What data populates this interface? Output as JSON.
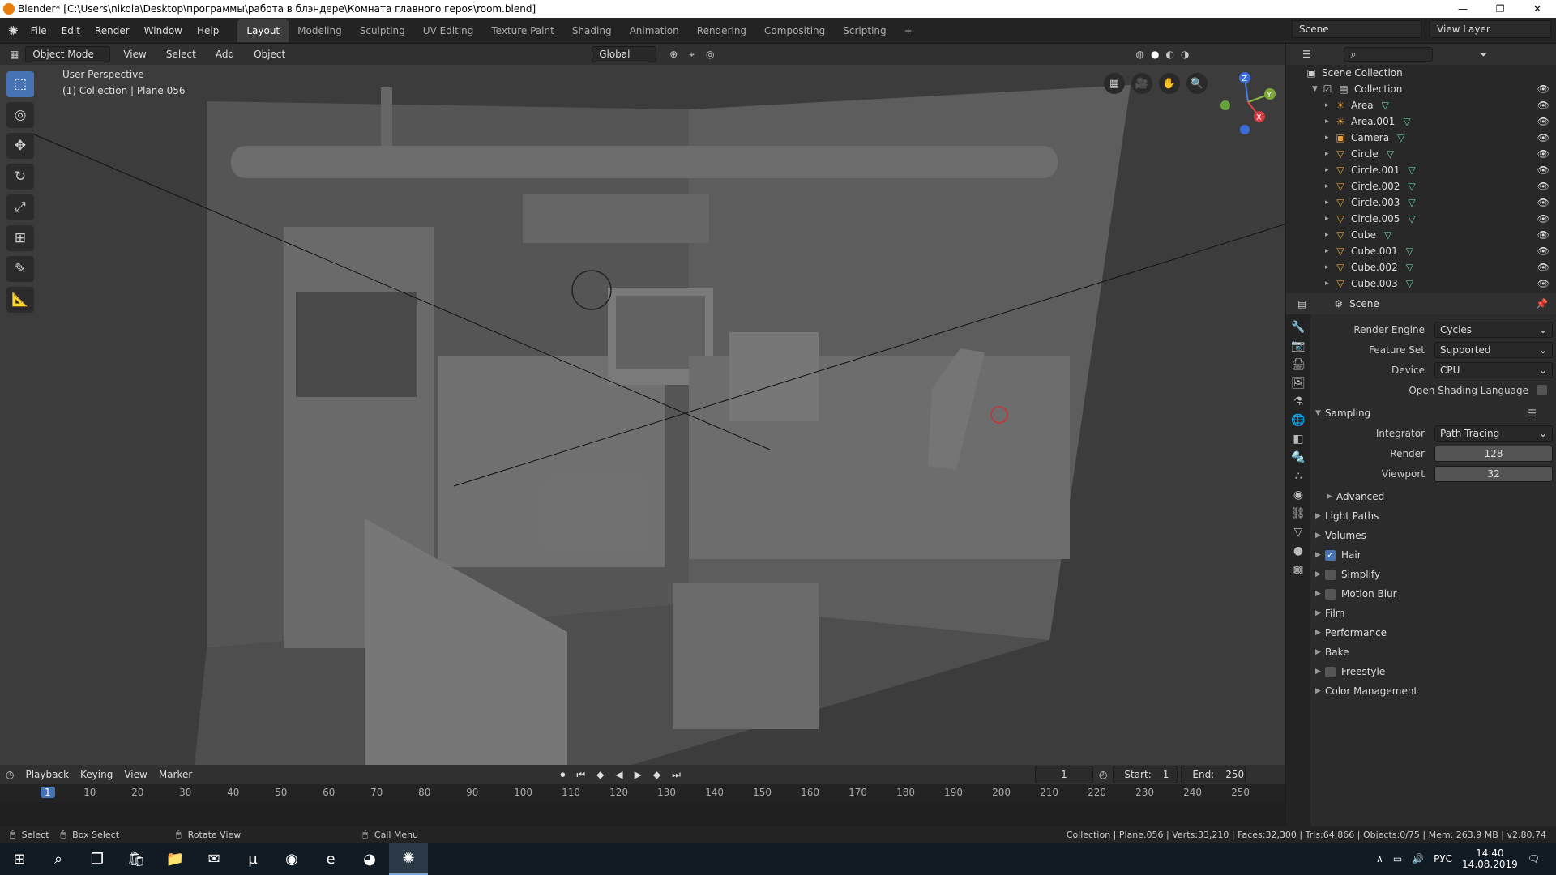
{
  "window": {
    "title": "Blender* [C:\\Users\\nikola\\Desktop\\программы\\работа в блэндере\\Комната главного героя\\room.blend]",
    "minimize": "—",
    "restore": "❐",
    "close": "✕"
  },
  "menu": [
    "File",
    "Edit",
    "Render",
    "Window",
    "Help"
  ],
  "workspaces": [
    "Layout",
    "Modeling",
    "Sculpting",
    "UV Editing",
    "Texture Paint",
    "Shading",
    "Animation",
    "Rendering",
    "Compositing",
    "Scripting",
    "+"
  ],
  "top_right": {
    "scene": "Scene",
    "view_layer": "View Layer"
  },
  "header3d": {
    "mode": "Object Mode",
    "view": "View",
    "select": "Select",
    "add": "Add",
    "object": "Object",
    "orientation": "Global"
  },
  "viewport": {
    "perspective": "User Perspective",
    "collection_info": "(1) Collection | Plane.056"
  },
  "gizmo": {
    "x": "X",
    "y": "Y",
    "z": "Z"
  },
  "outliner": {
    "header": "Scene Collection",
    "collection": "Collection",
    "items": [
      {
        "name": "Area",
        "icon": "light-icon"
      },
      {
        "name": "Area.001",
        "icon": "light-icon"
      },
      {
        "name": "Camera",
        "icon": "camera-icon"
      },
      {
        "name": "Circle",
        "icon": "mesh-icon"
      },
      {
        "name": "Circle.001",
        "icon": "mesh-icon"
      },
      {
        "name": "Circle.002",
        "icon": "mesh-icon"
      },
      {
        "name": "Circle.003",
        "icon": "mesh-icon"
      },
      {
        "name": "Circle.005",
        "icon": "mesh-icon"
      },
      {
        "name": "Cube",
        "icon": "mesh-icon"
      },
      {
        "name": "Cube.001",
        "icon": "mesh-icon"
      },
      {
        "name": "Cube.002",
        "icon": "mesh-icon"
      },
      {
        "name": "Cube.003",
        "icon": "mesh-icon"
      }
    ]
  },
  "properties": {
    "context": "Scene",
    "render_engine_label": "Render Engine",
    "render_engine": "Cycles",
    "feature_set_label": "Feature Set",
    "feature_set": "Supported",
    "device_label": "Device",
    "device": "CPU",
    "osl_label": "Open Shading Language",
    "sampling": "Sampling",
    "integrator_label": "Integrator",
    "integrator": "Path Tracing",
    "render_label": "Render",
    "render_samples": "128",
    "viewport_label": "Viewport",
    "viewport_samples": "32",
    "advanced": "Advanced",
    "sections": [
      "Light Paths",
      "Volumes",
      "Hair",
      "Simplify",
      "Motion Blur",
      "Film",
      "Performance",
      "Bake",
      "Freestyle",
      "Color Management"
    ]
  },
  "timeline": {
    "playback": "Playback",
    "keying": "Keying",
    "view": "View",
    "marker": "Marker",
    "current_frame": "1",
    "start_label": "Start:",
    "start": "1",
    "end_label": "End:",
    "end": "250",
    "ticks": [
      "1",
      "10",
      "20",
      "30",
      "40",
      "50",
      "60",
      "70",
      "80",
      "90",
      "100",
      "110",
      "120",
      "130",
      "140",
      "150",
      "160",
      "170",
      "180",
      "190",
      "200",
      "210",
      "220",
      "230",
      "240",
      "250"
    ]
  },
  "status": {
    "select": "Select",
    "box_select": "Box Select",
    "rotate_view": "Rotate View",
    "call_menu": "Call Menu",
    "stats": "Collection | Plane.056 | Verts:33,210 | Faces:32,300 | Tris:64,866 | Objects:0/75 | Mem: 263.9 MB | v2.80.74"
  },
  "taskbar": {
    "lang": "РУС",
    "time": "14:40",
    "date": "14.08.2019"
  }
}
